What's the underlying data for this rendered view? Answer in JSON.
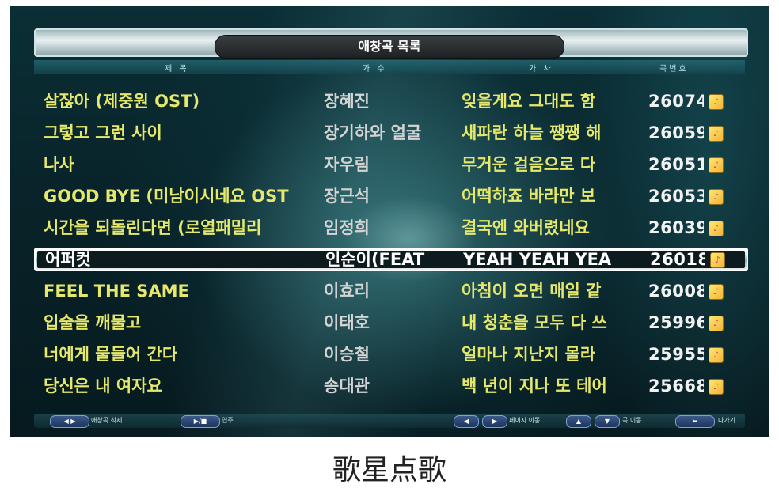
{
  "header": {
    "title": "애창곡 목록"
  },
  "columns": {
    "title": "제 목",
    "singer": "가 수",
    "lyric": "가 사",
    "number": "곡번호"
  },
  "songs": [
    {
      "title": "살잖아 (제중원 OST)",
      "singer": "장혜진",
      "lyric": "잊을게요 그대도 함",
      "number": "26074"
    },
    {
      "title": "그렇고 그런 사이",
      "singer": "장기하와 얼굴",
      "lyric": "새파란 하늘 쨍쨍 해",
      "number": "26059"
    },
    {
      "title": "나사",
      "singer": "자우림",
      "lyric": "무거운 걸음으로 다",
      "number": "26051"
    },
    {
      "title": "GOOD BYE (미남이시네요 OST",
      "singer": "장근석",
      "lyric": "어떡하죠 바라만 보",
      "number": "26053"
    },
    {
      "title": "시간을 되돌린다면 (로열패밀리",
      "singer": "임정희",
      "lyric": "결국엔 와버렸네요",
      "number": "26039"
    },
    {
      "title": "어퍼컷",
      "singer": "인순이(FEAT",
      "lyric": "YEAH YEAH YEA",
      "number": "26018",
      "selected": true
    },
    {
      "title": "FEEL THE SAME",
      "singer": "이효리",
      "lyric": "아침이 오면 매일 같",
      "number": "26008"
    },
    {
      "title": "입술을 깨물고",
      "singer": "이태호",
      "lyric": "내 청춘을 모두 다 쓰",
      "number": "25996"
    },
    {
      "title": "너에게 물들어 간다",
      "singer": "이승철",
      "lyric": "얼마나 지난지 몰라",
      "number": "25955"
    },
    {
      "title": "당신은 내 여자요",
      "singer": "송대관",
      "lyric": "백 년이 지나 또 테어",
      "number": "25668"
    }
  ],
  "badge_symbol": "♪",
  "footer": {
    "delete_key": "◀ ▶",
    "delete_label": "애창곡 삭제",
    "play_key": "▶/■",
    "play_label": "연주",
    "prev_key": "◀",
    "next_key": "▶",
    "page_label": "페이지 이동",
    "up_key": "▲",
    "down_key": "▼",
    "song_move_label": "곡 이동",
    "exit_key": "⬅",
    "exit_label": "나가기"
  },
  "caption": "歌星点歌"
}
